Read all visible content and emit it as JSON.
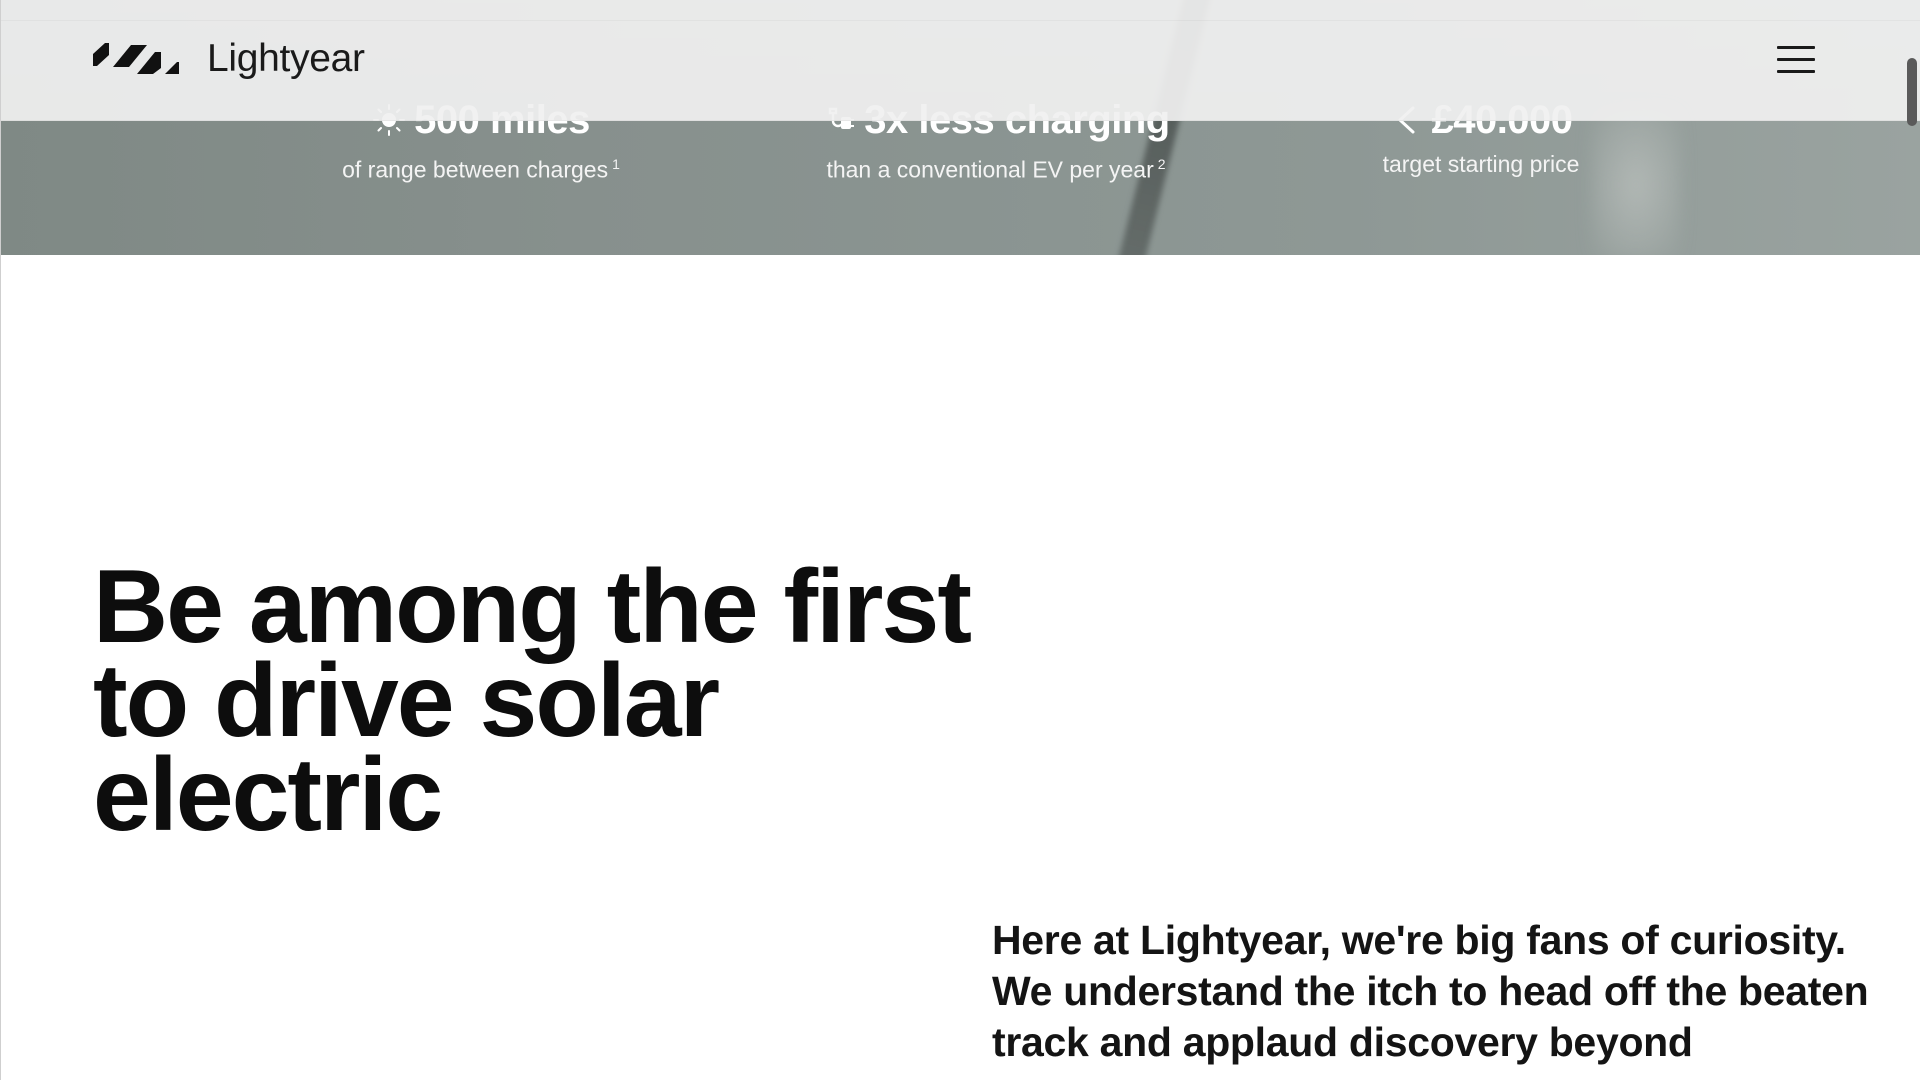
{
  "header": {
    "brand_name": "Lightyear",
    "menu_icon": "hamburger-menu-icon"
  },
  "stats": [
    {
      "icon": "sun-icon",
      "headline": "500 miles",
      "caption": "of range between charges",
      "footnote": "1"
    },
    {
      "icon": "charging-plug-icon",
      "headline": "3x less charging",
      "caption": "than a conventional EV per year",
      "footnote": "2"
    },
    {
      "icon": "less-than-icon",
      "headline": "£40.000",
      "caption": "target starting price",
      "footnote": ""
    }
  ],
  "main": {
    "headline": "Be among the first to drive solar electric",
    "intro": "Here at Lightyear, we're big fans of curiosity. We understand the itch to head off the beaten track and applaud discovery beyond"
  },
  "colors": {
    "text": "#111111",
    "header_bg": "#f0f0f0",
    "hero_overlay": "#87908d",
    "stat_text": "#ffffff"
  }
}
